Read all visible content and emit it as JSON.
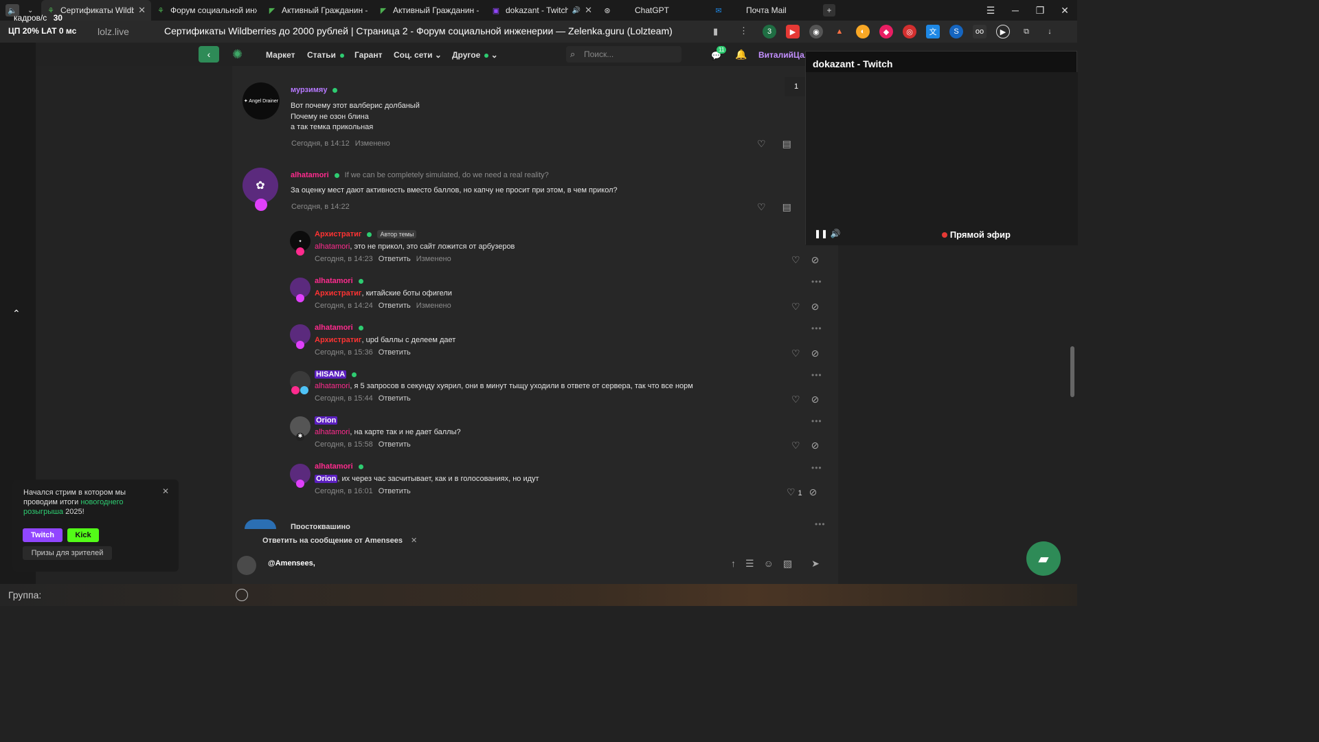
{
  "hud": {
    "fps_label": "кадров/с",
    "fps": "30",
    "line2": "ЦП 20% LAT 0 мс"
  },
  "tabs": [
    {
      "title": "Сертификаты Wildberr",
      "active": true
    },
    {
      "title": "Форум социальной инже"
    },
    {
      "title": "Активный Гражданин - п"
    },
    {
      "title": "Активный Гражданин - п"
    },
    {
      "title": "dokazant - Twitch"
    },
    {
      "title": "ChatGPT"
    },
    {
      "title": "Почта Mail"
    }
  ],
  "address": {
    "domain": "lolz.live",
    "title": "Сертификаты Wildberries до 2000 рублей | Страница 2 - Форум социальной инженерии — Zelenka.guru (Lolzteam)"
  },
  "nav": {
    "items": [
      "Маркет",
      "Статьи",
      "Гарант",
      "Соц. сети",
      "Другое"
    ],
    "search_placeholder": "Поиск...",
    "messages_badge": "11",
    "username": "ВиталийЦал"
  },
  "pager": "1",
  "posts": [
    {
      "user": "мурзимяу",
      "lines": [
        "Вот почему этот валберис долбаный",
        "Почему не озон блина",
        "а так темка прикольная"
      ],
      "time": "Сегодня, в 14:12",
      "edited": "Изменено"
    },
    {
      "user": "alhatamori",
      "subtitle": "If we can be completely simulated, do we need a real reality?",
      "lines": [
        "За оценку мест дают активность вместо баллов, но капчу не просит при этом, в чем прикол?"
      ],
      "time": "Сегодня, в 14:22"
    }
  ],
  "comments": [
    {
      "user": "Архистратиг",
      "tag": "Автор темы",
      "mention": "alhatamori",
      "text": ", это не прикол, это сайт ложится от арбузеров",
      "time": "Сегодня, в 14:23",
      "reply": "Ответить",
      "edited": "Изменено"
    },
    {
      "user": "alhatamori",
      "mention": "Архистратиг",
      "text": ", китайские боты офигели",
      "time": "Сегодня, в 14:24",
      "reply": "Ответить",
      "edited": "Изменено"
    },
    {
      "user": "alhatamori",
      "mention": "Архистратиг",
      "text": ", upd баллы с делеем дает",
      "time": "Сегодня, в 15:36",
      "reply": "Ответить"
    },
    {
      "user": "HISANA",
      "mention": "alhatamori",
      "text": ", я 5 запросов в секунду хуярил, они в минут тыщу уходили в ответе от сервера, так что все норм",
      "time": "Сегодня, в 15:44",
      "reply": "Ответить"
    },
    {
      "user": "Orion",
      "mention": "alhatamori",
      "text": ", на карте так и не дает баллы?",
      "time": "Сегодня, в 15:58",
      "reply": "Ответить"
    },
    {
      "user": "alhatamori",
      "mention": "Orion",
      "text": ", их через час засчитывает, как и в голосованиях, но идут",
      "time": "Сегодня, в 16:01",
      "reply": "Ответить",
      "likes": "1"
    }
  ],
  "next_user": "Простоквашино",
  "video": {
    "title": "dokazant - Twitch",
    "live": "Прямой эфир"
  },
  "notice": {
    "text_before": "Начался стрим в котором мы проводим итоги ",
    "link": "новогоднего розыгрыша",
    "text_after": " 2025!",
    "twitch": "Twitch",
    "kick": "Kick",
    "prizes": "Призы для зрителей"
  },
  "reply_to": "Ответить на сообщение от Amensees",
  "composer_value": "@Amensees,",
  "bottom": {
    "group_label": "Группа:"
  },
  "colors": {
    "accent": "#2e8b57",
    "purple": "#b779ff",
    "pink": "#ff2b8e",
    "highlight": "#5b1fbf"
  }
}
